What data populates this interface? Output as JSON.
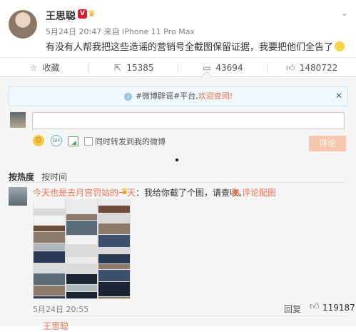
{
  "post": {
    "author": "王思聪",
    "verified_badge": "V",
    "meta": "5月24日 20:47 来自 iPhone 11 Pro Max",
    "content": "有没有人帮我把这些造谣的营销号全截图保留证据，我要把他们全告了",
    "actions": {
      "favorite": "收藏",
      "repost": "15385",
      "comment": "43694",
      "like": "1480722"
    }
  },
  "notice": {
    "prefix": "#微博辟谣#平台,",
    "link": "欢迎查阅!"
  },
  "composer": {
    "placeholder": "",
    "repost_checkbox_label": "同时转发到我的微博",
    "submit_label": "评论",
    "gif_label": "GIF"
  },
  "sort": {
    "by_hot": "按热度",
    "by_time": "按时间"
  },
  "comment": {
    "author": "今天也是去月宫罚站的一天",
    "text": "：我给你截了个图，请查收。",
    "pic_label": "评论配图",
    "time": "5月24日 20:55",
    "reply_label": "回复",
    "likes": "119187",
    "next_partial": "王思聪"
  },
  "colors": {
    "accent": "#eb7350",
    "verified": "#e6162d",
    "crown": "#f3a21a"
  },
  "icons": [
    "chevron-down-icon",
    "star-icon",
    "repost-icon",
    "comment-icon",
    "like-icon",
    "info-icon",
    "close-icon",
    "emoji-icon",
    "gif-icon",
    "image-icon"
  ]
}
